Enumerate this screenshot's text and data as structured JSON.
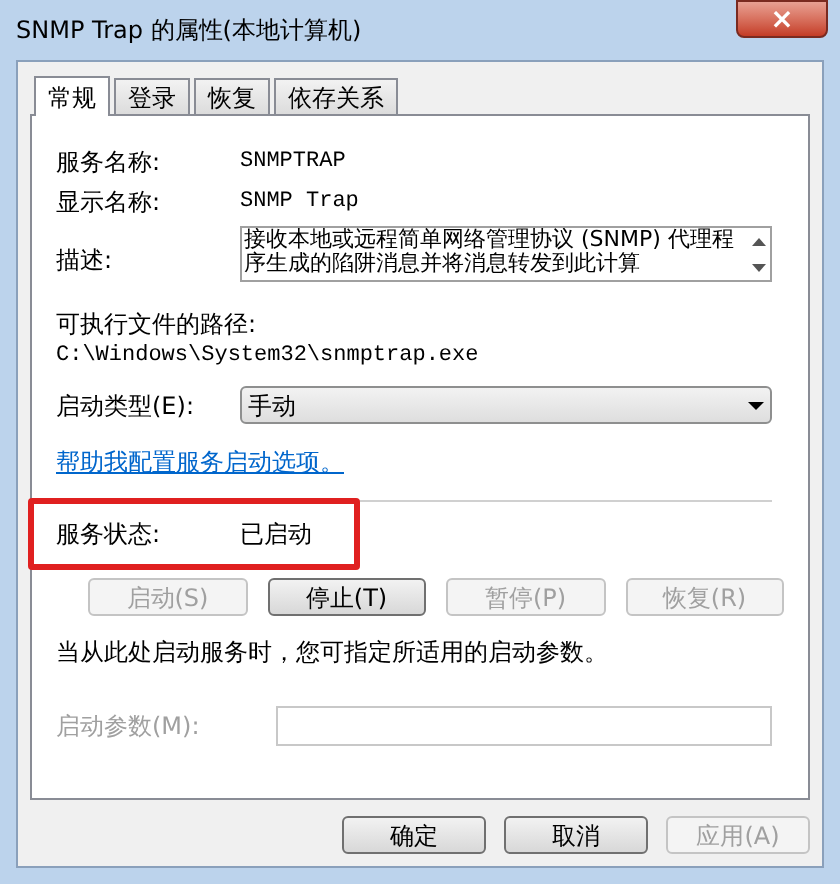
{
  "window": {
    "title": "SNMP Trap 的属性(本地计算机)",
    "close": "×"
  },
  "tabs": [
    {
      "label": "常规",
      "selected": true
    },
    {
      "label": "登录",
      "selected": false
    },
    {
      "label": "恢复",
      "selected": false
    },
    {
      "label": "依存关系",
      "selected": false
    }
  ],
  "fields": {
    "service_name_label": "服务名称:",
    "service_name": "SNMPTRAP",
    "display_name_label": "显示名称:",
    "display_name": "SNMP Trap",
    "description_label": "描述:",
    "description": "接收本地或远程简单网络管理协议 (SNMP) 代理程序生成的陷阱消息并将消息转发到此计算",
    "path_label": "可执行文件的路径:",
    "path": "C:\\Windows\\System32\\snmptrap.exe",
    "startup_type_label": "启动类型(E):",
    "startup_type": "手动"
  },
  "help_link": "帮助我配置服务启动选项。",
  "status": {
    "label": "服务状态:",
    "value": "已启动",
    "highlighted": true
  },
  "service_buttons": [
    {
      "label": "启动(S)",
      "disabled": true
    },
    {
      "label": "停止(T)",
      "disabled": false
    },
    {
      "label": "暂停(P)",
      "disabled": true
    },
    {
      "label": "恢复(R)",
      "disabled": true
    }
  ],
  "hint": "当从此处启动服务时，您可指定所适用的启动参数。",
  "start_params": {
    "label": "启动参数(M):",
    "disabled": true
  },
  "dialog_buttons": [
    {
      "label": "确定",
      "disabled": false
    },
    {
      "label": "取消",
      "disabled": false
    },
    {
      "label": "应用(A)",
      "disabled": true
    }
  ]
}
